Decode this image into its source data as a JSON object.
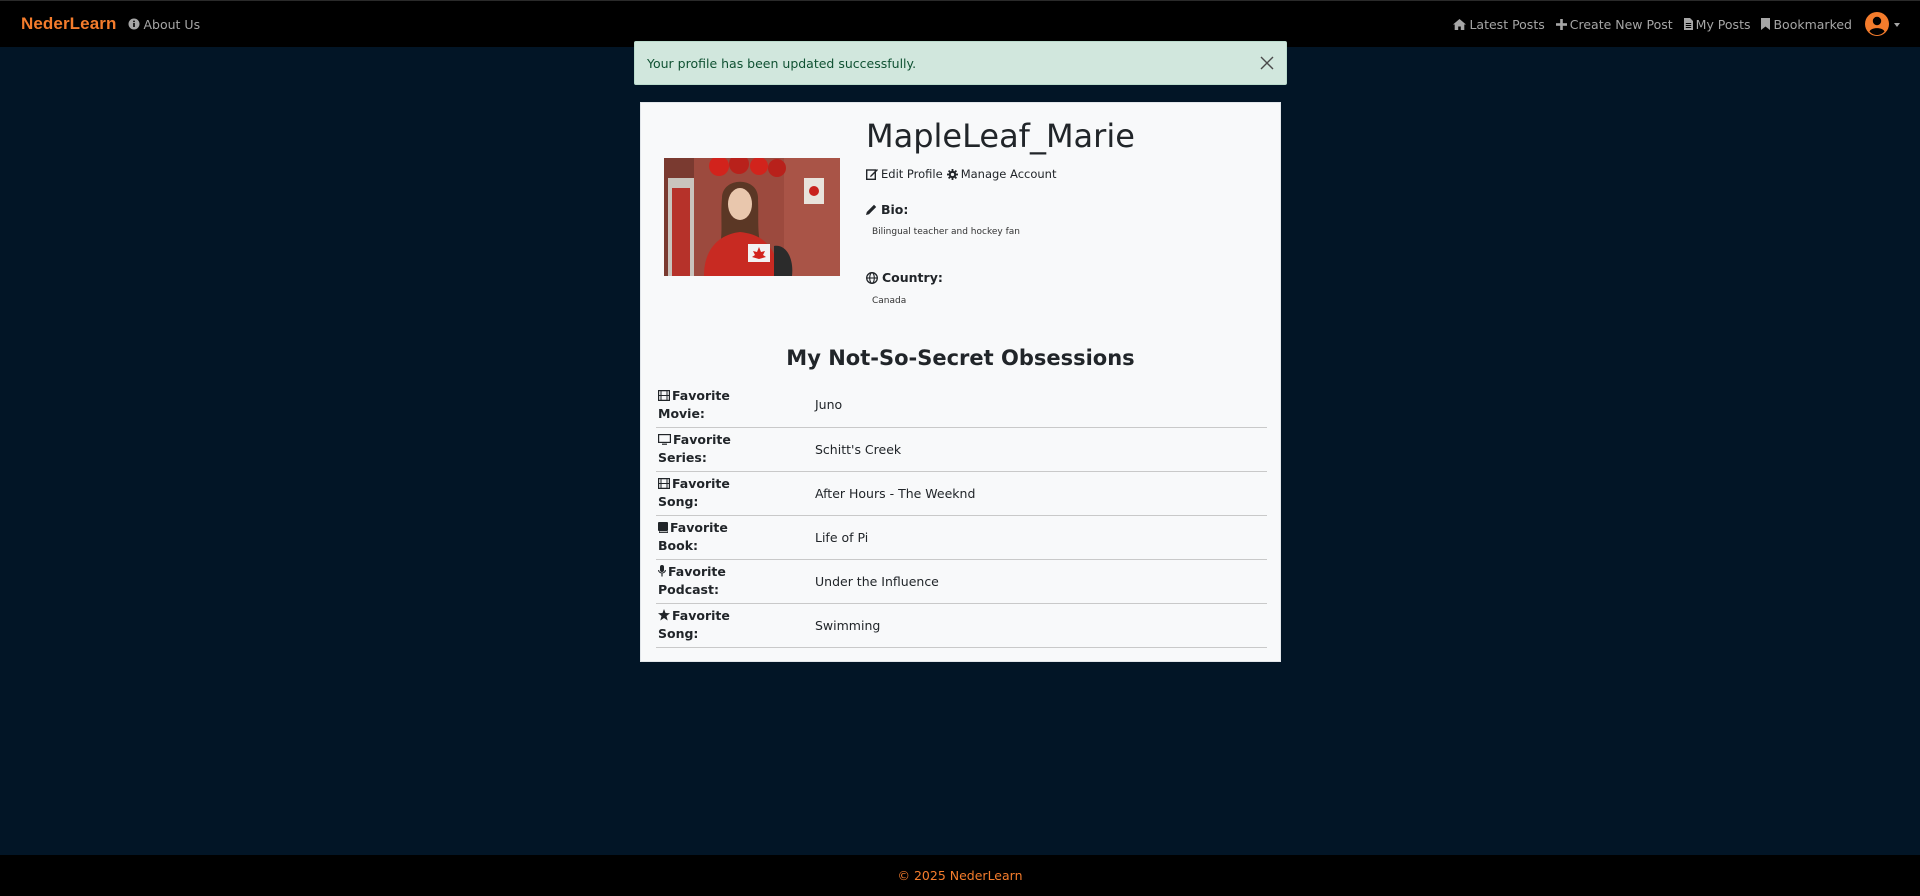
{
  "nav": {
    "brand": "NederLearn",
    "about": "About Us",
    "links": [
      {
        "label": "Latest Posts",
        "icon": "home-icon"
      },
      {
        "label": "Create New Post",
        "icon": "plus-icon"
      },
      {
        "label": "My Posts",
        "icon": "file-icon"
      },
      {
        "label": "Bookmarked",
        "icon": "bookmark-icon"
      }
    ],
    "accent_color": "#f47c2c"
  },
  "alert": {
    "message": "Your profile has been updated successfully."
  },
  "profile": {
    "username": "MapleLeaf_Marie",
    "edit_label": "Edit Profile",
    "manage_label": "Manage Account",
    "bio_label": "Bio:",
    "bio": "Bilingual teacher and hockey fan",
    "country_label": "Country:",
    "country": "Canada"
  },
  "obsessions": {
    "title": "My Not-So-Secret Obsessions",
    "rows": [
      {
        "icon": "film-icon",
        "label_1": "Favorite",
        "label_2": "Movie:",
        "value": "Juno"
      },
      {
        "icon": "tv-icon",
        "label_1": "Favorite",
        "label_2": "Series:",
        "value": "Schitt's Creek"
      },
      {
        "icon": "film-icon",
        "label_1": "Favorite",
        "label_2": "Song:",
        "value": "After Hours - The Weeknd"
      },
      {
        "icon": "book-icon",
        "label_1": "Favorite",
        "label_2": "Book:",
        "value": "Life of Pi"
      },
      {
        "icon": "microphone-icon",
        "label_1": "Favorite",
        "label_2": "Podcast:",
        "value": "Under the Influence"
      },
      {
        "icon": "star-icon",
        "label_1": "Favorite",
        "label_2": "Song:",
        "value": "Swimming"
      }
    ]
  },
  "footer": {
    "text": "© 2025 NederLearn"
  }
}
